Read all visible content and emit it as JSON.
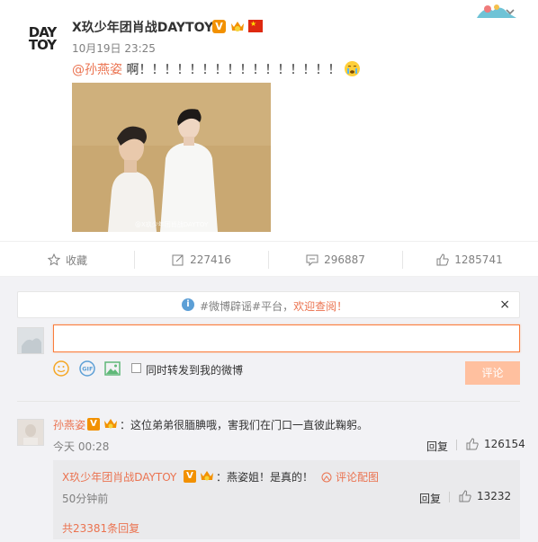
{
  "post": {
    "avatar_text_line1": "DAY",
    "avatar_text_line2": "TOY",
    "author": "X玖少年团肖战DAYTOY",
    "vip_badge": "V",
    "time": "10月19日 23:25",
    "mention": "@孙燕姿",
    "text": " 啊！！！！！！！！！！！！！！！！",
    "icons": [
      "chevron-down-icon",
      "verified-v-icon",
      "vip-crown-icon",
      "china-flag-icon",
      "crying-emoji-icon"
    ]
  },
  "actions": {
    "favorite_label": "收藏",
    "forward_count": "227416",
    "comment_count": "296887",
    "like_count": "1285741"
  },
  "composer": {
    "notice_prefix": "#微博辟谣#平台，",
    "notice_link": "欢迎查阅！",
    "close_label": "×",
    "input_value": "",
    "sync_label": "同时转发到我的微博",
    "submit_label": "评论",
    "tool_icons": [
      "emoji-icon",
      "gif-icon",
      "image-icon"
    ]
  },
  "comment": {
    "author": "孙燕姿",
    "vip_badge": "V",
    "text": "：这位弟弟很腼腆哦，害我们在门口一直彼此鞠躬。",
    "time": "今天 00:28",
    "reply_label": "回复",
    "like_count": "126154",
    "reply": {
      "author": "X玖少年团肖战DAYTOY",
      "vip_badge": "V",
      "text": "：燕姿姐！是真的！",
      "pic_label": "评论配图",
      "time": "50分钟前",
      "reply_label": "回复",
      "like_count": "13232"
    },
    "more_replies": "共23381条回复"
  },
  "colors": {
    "accent": "#eb7350",
    "vip_orange": "#f29100",
    "submit_disabled": "#ffc09f",
    "comment_bg": "#f2f2f5"
  }
}
